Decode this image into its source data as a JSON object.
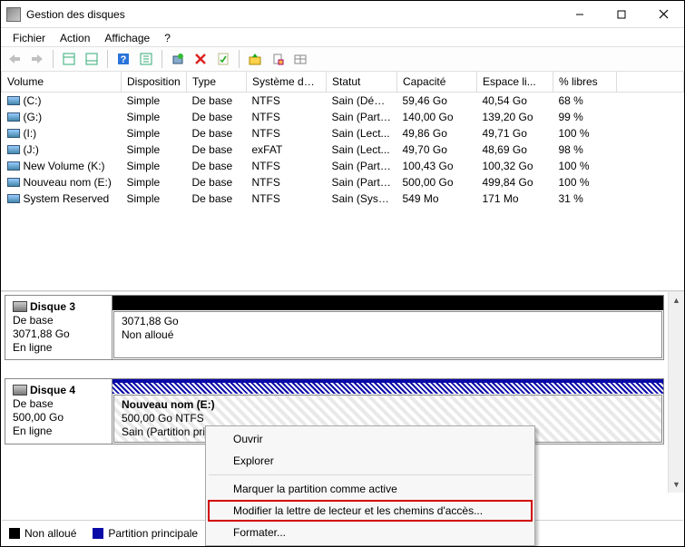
{
  "window": {
    "title": "Gestion des disques"
  },
  "menu": {
    "file": "Fichier",
    "action": "Action",
    "view": "Affichage",
    "help": "?"
  },
  "columns": {
    "volume": "Volume",
    "layout": "Disposition",
    "type": "Type",
    "fs": "Système de ...",
    "status": "Statut",
    "capacity": "Capacité",
    "free": "Espace li...",
    "pctfree": "% libres"
  },
  "volumes": [
    {
      "name": "(C:)",
      "layout": "Simple",
      "type": "De base",
      "fs": "NTFS",
      "status": "Sain (Dém...",
      "cap": "59,46 Go",
      "free": "40,54 Go",
      "pct": "68 %"
    },
    {
      "name": "(G:)",
      "layout": "Simple",
      "type": "De base",
      "fs": "NTFS",
      "status": "Sain (Parti...",
      "cap": "140,00 Go",
      "free": "139,20 Go",
      "pct": "99 %"
    },
    {
      "name": "(I:)",
      "layout": "Simple",
      "type": "De base",
      "fs": "NTFS",
      "status": "Sain (Lect...",
      "cap": "49,86 Go",
      "free": "49,71 Go",
      "pct": "100 %"
    },
    {
      "name": "(J:)",
      "layout": "Simple",
      "type": "De base",
      "fs": "exFAT",
      "status": "Sain (Lect...",
      "cap": "49,70 Go",
      "free": "48,69 Go",
      "pct": "98 %"
    },
    {
      "name": "New Volume (K:)",
      "layout": "Simple",
      "type": "De base",
      "fs": "NTFS",
      "status": "Sain (Parti...",
      "cap": "100,43 Go",
      "free": "100,32 Go",
      "pct": "100 %"
    },
    {
      "name": "Nouveau nom (E:)",
      "layout": "Simple",
      "type": "De base",
      "fs": "NTFS",
      "status": "Sain (Parti...",
      "cap": "500,00 Go",
      "free": "499,84 Go",
      "pct": "100 %"
    },
    {
      "name": "System Reserved",
      "layout": "Simple",
      "type": "De base",
      "fs": "NTFS",
      "status": "Sain (Systè...",
      "cap": "549 Mo",
      "free": "171 Mo",
      "pct": "31 %"
    }
  ],
  "disks": {
    "d3": {
      "title": "Disque 3",
      "type": "De base",
      "size": "3071,88 Go",
      "state": "En ligne",
      "part_size": "3071,88 Go",
      "part_state": "Non alloué"
    },
    "d4": {
      "title": "Disque 4",
      "type": "De base",
      "size": "500,00 Go",
      "state": "En ligne",
      "part_title": "Nouveau nom  (E:)",
      "part_line2": "500,00 Go NTFS",
      "part_line3": "Sain (Partition pri"
    }
  },
  "legend": {
    "unalloc": "Non alloué",
    "primary": "Partition principale"
  },
  "ctx": {
    "open": "Ouvrir",
    "explore": "Explorer",
    "markactive": "Marquer la partition comme active",
    "changeletter": "Modifier la lettre de lecteur et les chemins d'accès...",
    "format": "Formater..."
  }
}
